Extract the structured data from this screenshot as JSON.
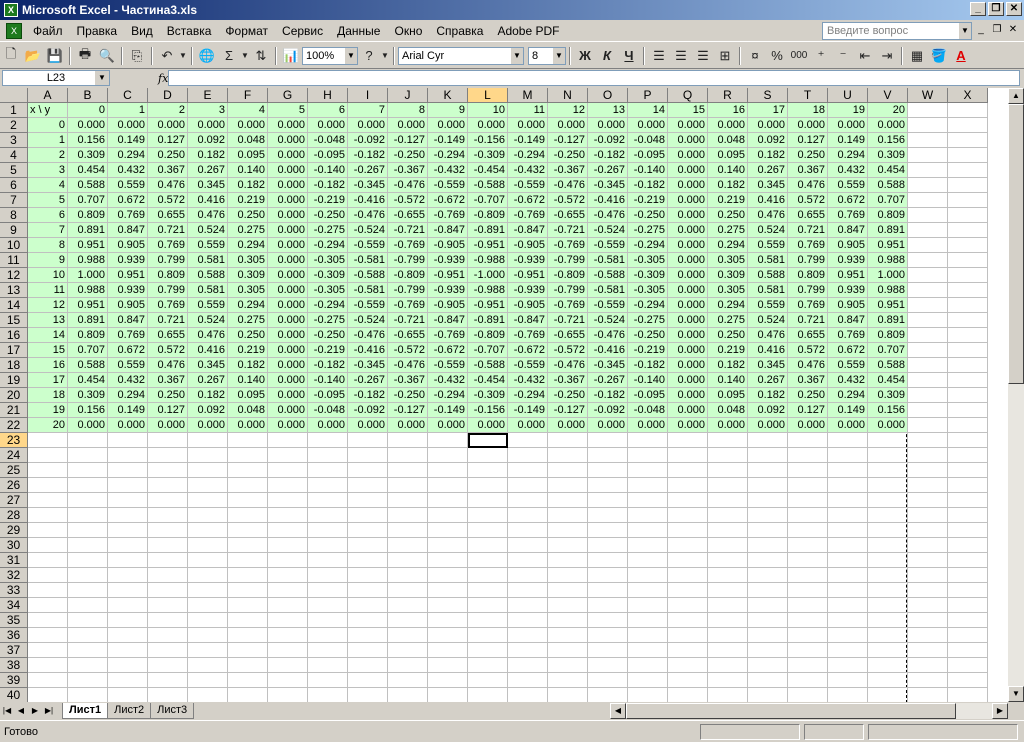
{
  "window": {
    "title": "Microsoft Excel - Частина3.xls",
    "icon": "X"
  },
  "menu": [
    "Файл",
    "Правка",
    "Вид",
    "Вставка",
    "Формат",
    "Сервис",
    "Данные",
    "Окно",
    "Справка",
    "Adobe PDF"
  ],
  "help_placeholder": "Введите вопрос",
  "toolbar": {
    "zoom": "100%",
    "font": "Arial Cyr",
    "size": "8",
    "bold": "Ж",
    "italic": "К",
    "underline": "Ч",
    "percent": "%",
    "thousands": "000",
    "sigma": "Σ"
  },
  "namebox": "L23",
  "fx": "fx",
  "columns": [
    "A",
    "B",
    "C",
    "D",
    "E",
    "F",
    "G",
    "H",
    "I",
    "J",
    "K",
    "L",
    "M",
    "N",
    "O",
    "P",
    "Q",
    "R",
    "S",
    "T",
    "U",
    "V",
    "W",
    "X"
  ],
  "selected_column": "L",
  "header_row": [
    "x \\ y",
    "0",
    "1",
    "2",
    "3",
    "4",
    "5",
    "6",
    "7",
    "8",
    "9",
    "10",
    "11",
    "12",
    "13",
    "14",
    "15",
    "16",
    "17",
    "18",
    "19",
    "20"
  ],
  "rows": [
    [
      "0",
      "0.000",
      "0.000",
      "0.000",
      "0.000",
      "0.000",
      "0.000",
      "0.000",
      "0.000",
      "0.000",
      "0.000",
      "0.000",
      "0.000",
      "0.000",
      "0.000",
      "0.000",
      "0.000",
      "0.000",
      "0.000",
      "0.000",
      "0.000",
      "0.000"
    ],
    [
      "1",
      "0.156",
      "0.149",
      "0.127",
      "0.092",
      "0.048",
      "0.000",
      "-0.048",
      "-0.092",
      "-0.127",
      "-0.149",
      "-0.156",
      "-0.149",
      "-0.127",
      "-0.092",
      "-0.048",
      "0.000",
      "0.048",
      "0.092",
      "0.127",
      "0.149",
      "0.156"
    ],
    [
      "2",
      "0.309",
      "0.294",
      "0.250",
      "0.182",
      "0.095",
      "0.000",
      "-0.095",
      "-0.182",
      "-0.250",
      "-0.294",
      "-0.309",
      "-0.294",
      "-0.250",
      "-0.182",
      "-0.095",
      "0.000",
      "0.095",
      "0.182",
      "0.250",
      "0.294",
      "0.309"
    ],
    [
      "3",
      "0.454",
      "0.432",
      "0.367",
      "0.267",
      "0.140",
      "0.000",
      "-0.140",
      "-0.267",
      "-0.367",
      "-0.432",
      "-0.454",
      "-0.432",
      "-0.367",
      "-0.267",
      "-0.140",
      "0.000",
      "0.140",
      "0.267",
      "0.367",
      "0.432",
      "0.454"
    ],
    [
      "4",
      "0.588",
      "0.559",
      "0.476",
      "0.345",
      "0.182",
      "0.000",
      "-0.182",
      "-0.345",
      "-0.476",
      "-0.559",
      "-0.588",
      "-0.559",
      "-0.476",
      "-0.345",
      "-0.182",
      "0.000",
      "0.182",
      "0.345",
      "0.476",
      "0.559",
      "0.588"
    ],
    [
      "5",
      "0.707",
      "0.672",
      "0.572",
      "0.416",
      "0.219",
      "0.000",
      "-0.219",
      "-0.416",
      "-0.572",
      "-0.672",
      "-0.707",
      "-0.672",
      "-0.572",
      "-0.416",
      "-0.219",
      "0.000",
      "0.219",
      "0.416",
      "0.572",
      "0.672",
      "0.707"
    ],
    [
      "6",
      "0.809",
      "0.769",
      "0.655",
      "0.476",
      "0.250",
      "0.000",
      "-0.250",
      "-0.476",
      "-0.655",
      "-0.769",
      "-0.809",
      "-0.769",
      "-0.655",
      "-0.476",
      "-0.250",
      "0.000",
      "0.250",
      "0.476",
      "0.655",
      "0.769",
      "0.809"
    ],
    [
      "7",
      "0.891",
      "0.847",
      "0.721",
      "0.524",
      "0.275",
      "0.000",
      "-0.275",
      "-0.524",
      "-0.721",
      "-0.847",
      "-0.891",
      "-0.847",
      "-0.721",
      "-0.524",
      "-0.275",
      "0.000",
      "0.275",
      "0.524",
      "0.721",
      "0.847",
      "0.891"
    ],
    [
      "8",
      "0.951",
      "0.905",
      "0.769",
      "0.559",
      "0.294",
      "0.000",
      "-0.294",
      "-0.559",
      "-0.769",
      "-0.905",
      "-0.951",
      "-0.905",
      "-0.769",
      "-0.559",
      "-0.294",
      "0.000",
      "0.294",
      "0.559",
      "0.769",
      "0.905",
      "0.951"
    ],
    [
      "9",
      "0.988",
      "0.939",
      "0.799",
      "0.581",
      "0.305",
      "0.000",
      "-0.305",
      "-0.581",
      "-0.799",
      "-0.939",
      "-0.988",
      "-0.939",
      "-0.799",
      "-0.581",
      "-0.305",
      "0.000",
      "0.305",
      "0.581",
      "0.799",
      "0.939",
      "0.988"
    ],
    [
      "10",
      "1.000",
      "0.951",
      "0.809",
      "0.588",
      "0.309",
      "0.000",
      "-0.309",
      "-0.588",
      "-0.809",
      "-0.951",
      "-1.000",
      "-0.951",
      "-0.809",
      "-0.588",
      "-0.309",
      "0.000",
      "0.309",
      "0.588",
      "0.809",
      "0.951",
      "1.000"
    ],
    [
      "11",
      "0.988",
      "0.939",
      "0.799",
      "0.581",
      "0.305",
      "0.000",
      "-0.305",
      "-0.581",
      "-0.799",
      "-0.939",
      "-0.988",
      "-0.939",
      "-0.799",
      "-0.581",
      "-0.305",
      "0.000",
      "0.305",
      "0.581",
      "0.799",
      "0.939",
      "0.988"
    ],
    [
      "12",
      "0.951",
      "0.905",
      "0.769",
      "0.559",
      "0.294",
      "0.000",
      "-0.294",
      "-0.559",
      "-0.769",
      "-0.905",
      "-0.951",
      "-0.905",
      "-0.769",
      "-0.559",
      "-0.294",
      "0.000",
      "0.294",
      "0.559",
      "0.769",
      "0.905",
      "0.951"
    ],
    [
      "13",
      "0.891",
      "0.847",
      "0.721",
      "0.524",
      "0.275",
      "0.000",
      "-0.275",
      "-0.524",
      "-0.721",
      "-0.847",
      "-0.891",
      "-0.847",
      "-0.721",
      "-0.524",
      "-0.275",
      "0.000",
      "0.275",
      "0.524",
      "0.721",
      "0.847",
      "0.891"
    ],
    [
      "14",
      "0.809",
      "0.769",
      "0.655",
      "0.476",
      "0.250",
      "0.000",
      "-0.250",
      "-0.476",
      "-0.655",
      "-0.769",
      "-0.809",
      "-0.769",
      "-0.655",
      "-0.476",
      "-0.250",
      "0.000",
      "0.250",
      "0.476",
      "0.655",
      "0.769",
      "0.809"
    ],
    [
      "15",
      "0.707",
      "0.672",
      "0.572",
      "0.416",
      "0.219",
      "0.000",
      "-0.219",
      "-0.416",
      "-0.572",
      "-0.672",
      "-0.707",
      "-0.672",
      "-0.572",
      "-0.416",
      "-0.219",
      "0.000",
      "0.219",
      "0.416",
      "0.572",
      "0.672",
      "0.707"
    ],
    [
      "16",
      "0.588",
      "0.559",
      "0.476",
      "0.345",
      "0.182",
      "0.000",
      "-0.182",
      "-0.345",
      "-0.476",
      "-0.559",
      "-0.588",
      "-0.559",
      "-0.476",
      "-0.345",
      "-0.182",
      "0.000",
      "0.182",
      "0.345",
      "0.476",
      "0.559",
      "0.588"
    ],
    [
      "17",
      "0.454",
      "0.432",
      "0.367",
      "0.267",
      "0.140",
      "0.000",
      "-0.140",
      "-0.267",
      "-0.367",
      "-0.432",
      "-0.454",
      "-0.432",
      "-0.367",
      "-0.267",
      "-0.140",
      "0.000",
      "0.140",
      "0.267",
      "0.367",
      "0.432",
      "0.454"
    ],
    [
      "18",
      "0.309",
      "0.294",
      "0.250",
      "0.182",
      "0.095",
      "0.000",
      "-0.095",
      "-0.182",
      "-0.250",
      "-0.294",
      "-0.309",
      "-0.294",
      "-0.250",
      "-0.182",
      "-0.095",
      "0.000",
      "0.095",
      "0.182",
      "0.250",
      "0.294",
      "0.309"
    ],
    [
      "19",
      "0.156",
      "0.149",
      "0.127",
      "0.092",
      "0.048",
      "0.000",
      "-0.048",
      "-0.092",
      "-0.127",
      "-0.149",
      "-0.156",
      "-0.149",
      "-0.127",
      "-0.092",
      "-0.048",
      "0.000",
      "0.048",
      "0.092",
      "0.127",
      "0.149",
      "0.156"
    ],
    [
      "20",
      "0.000",
      "0.000",
      "0.000",
      "0.000",
      "0.000",
      "0.000",
      "0.000",
      "0.000",
      "0.000",
      "0.000",
      "0.000",
      "0.000",
      "0.000",
      "0.000",
      "0.000",
      "0.000",
      "0.000",
      "0.000",
      "0.000",
      "0.000",
      "0.000"
    ]
  ],
  "selected_row": 23,
  "row_count": 40,
  "sheets": [
    "Лист1",
    "Лист2",
    "Лист3"
  ],
  "active_sheet": "Лист1",
  "status": "Готово",
  "colors": {
    "data_fill": "#ccffcc",
    "title_gradient_start": "#0a246a",
    "selection_header": "#ffd78a"
  }
}
